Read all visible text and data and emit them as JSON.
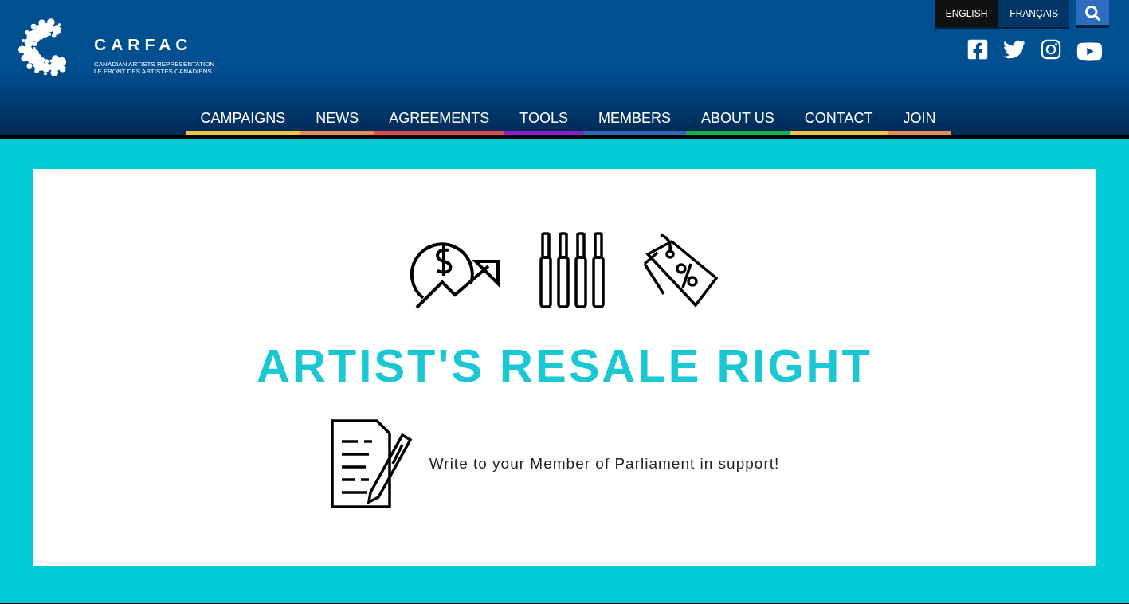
{
  "logo": {
    "name": "CARFAC",
    "tagline_1": "CANADIAN ARTISTS REPRESENTATION",
    "tagline_2": "LE FRONT DES ARTISTES CANADIENS"
  },
  "languages": [
    {
      "label": "ENGLISH",
      "selected": true
    },
    {
      "label": "FRANÇAIS",
      "selected": false
    }
  ],
  "social": [
    {
      "kind": "facebook"
    },
    {
      "kind": "twitter"
    },
    {
      "kind": "instagram"
    },
    {
      "kind": "youtube"
    }
  ],
  "nav": [
    {
      "label": "CAMPAIGNS",
      "color": "#f6c244"
    },
    {
      "label": "NEWS",
      "color": "#ef8a53"
    },
    {
      "label": "AGREEMENTS",
      "color": "#e0474f"
    },
    {
      "label": "TOOLS",
      "color": "#8a1ccc"
    },
    {
      "label": "MEMBERS",
      "color": "#3468b4"
    },
    {
      "label": "ABOUT US",
      "color": "#13b34a"
    },
    {
      "label": "CONTACT",
      "color": "#f6c244"
    },
    {
      "label": "JOIN",
      "color": "#ef8a53"
    }
  ],
  "banner": {
    "title": "ARTIST'S RESALE RIGHT",
    "message": "Write to your Member of Parliament in support!"
  }
}
